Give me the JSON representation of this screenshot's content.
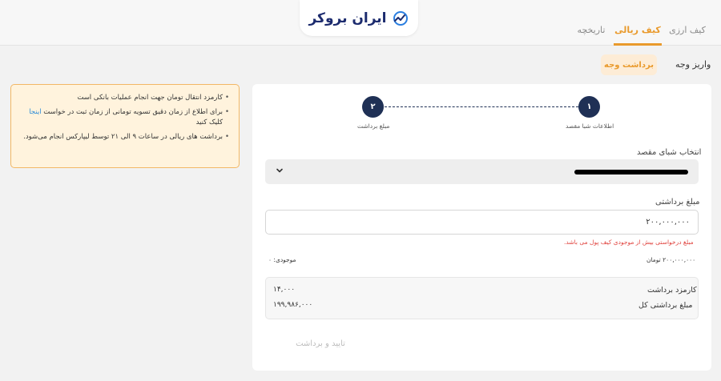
{
  "brand": {
    "name": "ایران بروکر"
  },
  "tabs": [
    {
      "label": "کیف ارزی",
      "active": false
    },
    {
      "label": "کیف ریالی",
      "active": true
    },
    {
      "label": "تاریخچه",
      "active": false
    }
  ],
  "subnav": {
    "deposit_label": "واریز وجه",
    "withdraw_label": "برداشت وجه"
  },
  "notice": {
    "items": [
      {
        "text": "کارمزد انتقال تومان جهت انجام عملیات بانکی است"
      },
      {
        "text_before": "برای اطلاع از زمان دقیق تسویه تومانی از زمان ثبت در خواست",
        "link": "اینجا",
        "text_after": "کلیک کنید"
      },
      {
        "text": "برداشت های ریالی در ساعات ۹ الی ۲۱ توسط لیپارکس انجام می‌شود."
      }
    ]
  },
  "stepper": {
    "steps": [
      {
        "number": "۱",
        "label": "اطلاعات شبا مقصد"
      },
      {
        "number": "۲",
        "label": "مبلغ برداشت"
      }
    ]
  },
  "form": {
    "sheba_label": "انتخاب شبای مقصد",
    "amount_label": "مبلغ برداشتی",
    "amount_value": "۲۰۰,۰۰۰,۰۰۰",
    "error_text": "مبلغ درخواستی بیش از موجودی کیف پول می باشد.",
    "amount_in_toman": "۲۰۰,۰۰۰,۰۰۰ تومان",
    "balance_text": "موجودی: ۰"
  },
  "summary": {
    "fee_label": "کارمزد برداشت",
    "fee_value": "۱۴,۰۰۰",
    "total_label": "مبلغ برداشتی کل",
    "total_value": "۱۹۹,۹۸۶,۰۰۰"
  },
  "confirm_label": "تایید و برداشت",
  "colors": {
    "accent": "#e99a2c",
    "navy": "#1f3055",
    "error": "#e0423d",
    "link": "#2a8ad8"
  }
}
